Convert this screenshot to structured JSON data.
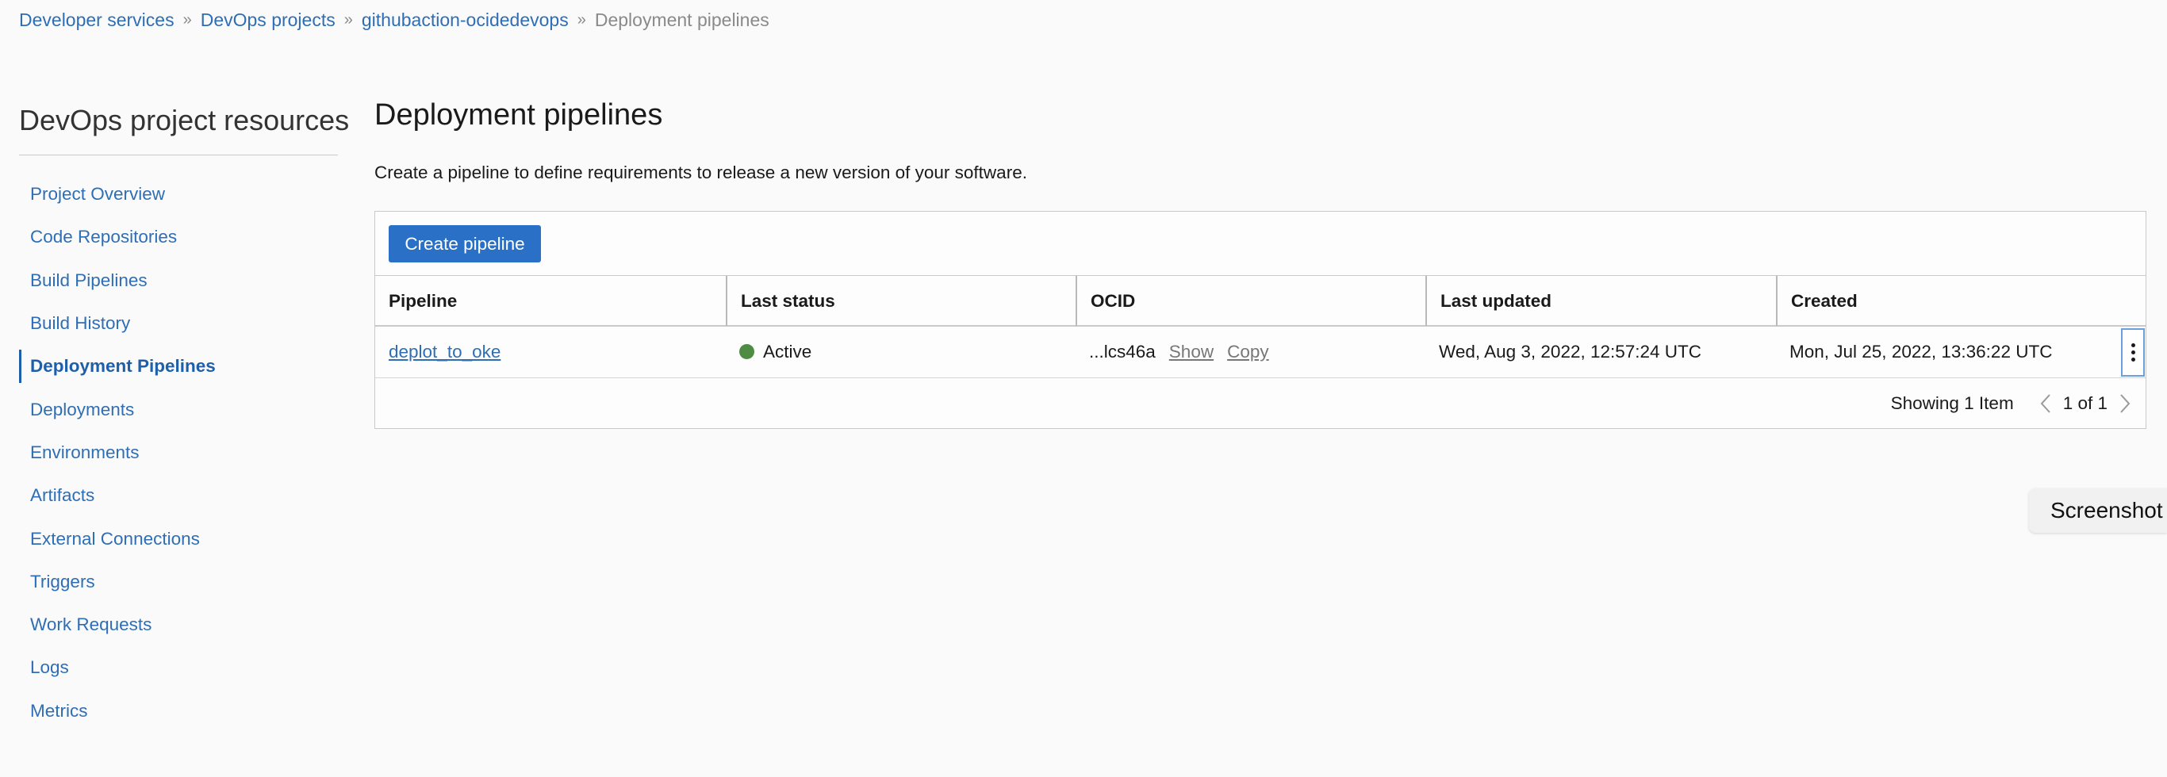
{
  "breadcrumb": {
    "items": [
      "Developer services",
      "DevOps projects",
      "githubaction-ocidedevops"
    ],
    "current": "Deployment pipelines",
    "separator": "»"
  },
  "sidebar": {
    "title": "DevOps project resources",
    "items": [
      {
        "label": "Project Overview"
      },
      {
        "label": "Code Repositories"
      },
      {
        "label": "Build Pipelines"
      },
      {
        "label": "Build History"
      },
      {
        "label": "Deployment Pipelines",
        "active": true
      },
      {
        "label": "Deployments"
      },
      {
        "label": "Environments"
      },
      {
        "label": "Artifacts"
      },
      {
        "label": "External Connections"
      },
      {
        "label": "Triggers"
      },
      {
        "label": "Work Requests"
      },
      {
        "label": "Logs"
      },
      {
        "label": "Metrics"
      }
    ]
  },
  "main": {
    "title": "Deployment pipelines",
    "description": "Create a pipeline to define requirements to release a new version of your software.",
    "create_button": "Create pipeline",
    "table": {
      "columns": [
        "Pipeline",
        "Last status",
        "OCID",
        "Last updated",
        "Created"
      ],
      "rows": [
        {
          "pipeline": "deplot_to_oke",
          "status": "Active",
          "ocid": "...lcs46a",
          "ocid_show": "Show",
          "ocid_copy": "Copy",
          "last_updated": "Wed, Aug 3, 2022, 12:57:24 UTC",
          "created": "Mon, Jul 25, 2022, 13:36:22 UTC"
        }
      ],
      "footer": {
        "showing": "Showing 1 Item",
        "page": "1 of 1"
      }
    }
  },
  "overlay": {
    "screenshot_label": "Screenshot"
  },
  "colors": {
    "link": "#2e6eb5",
    "primary_button": "#2a70c7",
    "status_active": "#4e8b43"
  }
}
